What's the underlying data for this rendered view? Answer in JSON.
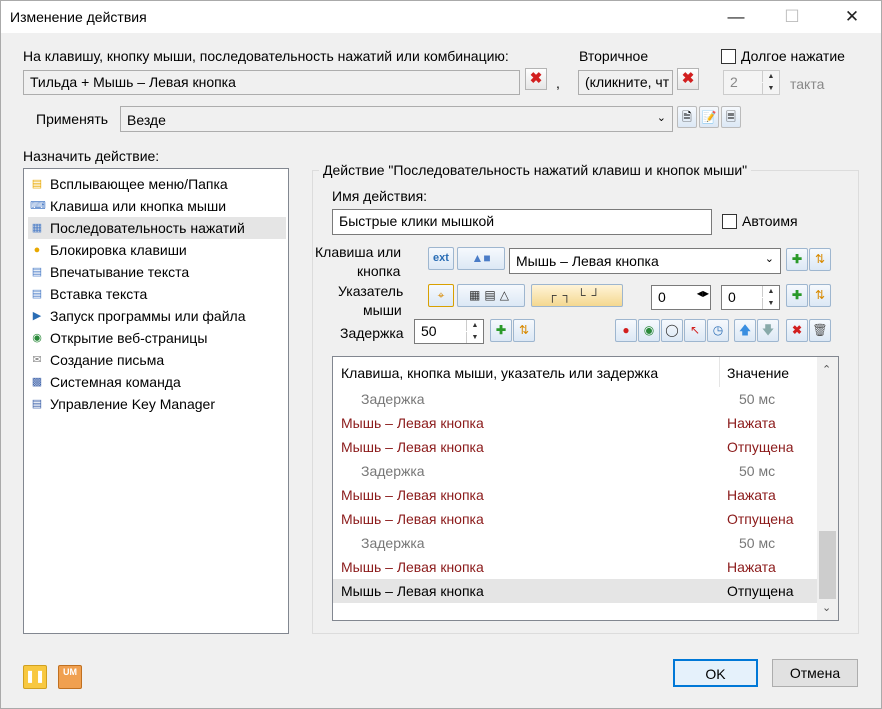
{
  "window": {
    "title": "Изменение действия"
  },
  "trigger": {
    "label": "На клавишу, кнопку мыши, последовательность нажатий или комбинацию:",
    "value": "Тильда + Мышь – Левая кнопка",
    "comma": ",",
    "secondary_label": "Вторичное",
    "secondary_value": "(кликните, чт",
    "long_press_label": "Долгое нажатие",
    "long_press_value": "2",
    "long_press_unit": "такта"
  },
  "apply": {
    "label": "Применять",
    "value": "Везде"
  },
  "assign": {
    "label": "Назначить действие:",
    "items": [
      {
        "label": "Всплывающее меню/Папка",
        "icon": "menu-icon"
      },
      {
        "label": "Клавиша или кнопка мыши",
        "icon": "key-icon"
      },
      {
        "label": "Последовательность нажатий",
        "icon": "sequence-icon"
      },
      {
        "label": "Блокировка клавиши",
        "icon": "lock-icon"
      },
      {
        "label": "Впечатывание текста",
        "icon": "text-icon"
      },
      {
        "label": "Вставка текста",
        "icon": "paste-icon"
      },
      {
        "label": "Запуск программы или файла",
        "icon": "run-icon"
      },
      {
        "label": "Открытие веб-страницы",
        "icon": "globe-icon"
      },
      {
        "label": "Создание письма",
        "icon": "mail-icon"
      },
      {
        "label": "Системная команда",
        "icon": "system-icon"
      },
      {
        "label": "Управление Key Manager",
        "icon": "manager-icon"
      }
    ]
  },
  "action": {
    "group_title": "Действие \"Последовательность нажатий клавиш и кнопок мыши\"",
    "name_label": "Имя действия:",
    "name_value": "Быстрые клики мышкой",
    "autoname_label": "Автоимя",
    "key_label_1": "Клавиша или",
    "key_label_2": "кнопка",
    "ext_label": "ext",
    "key_value": "Мышь – Левая кнопка",
    "pointer_label_1": "Указатель",
    "pointer_label_2": "мыши",
    "pointer_x": "0",
    "pointer_y": "0",
    "delay_label": "Задержка",
    "delay_value": "50"
  },
  "sequence": {
    "columns": [
      "Клавиша, кнопка мыши, указатель или задержка",
      "Значение"
    ],
    "rows": [
      {
        "item": "Задержка",
        "value": "50 мс",
        "kind": "delay"
      },
      {
        "item": "Мышь – Левая кнопка",
        "value": "Нажата",
        "kind": "mouse"
      },
      {
        "item": "Мышь – Левая кнопка",
        "value": "Отпущена",
        "kind": "mouse"
      },
      {
        "item": "Задержка",
        "value": "50 мс",
        "kind": "delay"
      },
      {
        "item": "Мышь – Левая кнопка",
        "value": "Нажата",
        "kind": "mouse"
      },
      {
        "item": "Мышь – Левая кнопка",
        "value": "Отпущена",
        "kind": "mouse"
      },
      {
        "item": "Задержка",
        "value": "50 мс",
        "kind": "delay"
      },
      {
        "item": "Мышь – Левая кнопка",
        "value": "Нажата",
        "kind": "mouse"
      },
      {
        "item": "Мышь – Левая кнопка",
        "value": "Отпущена",
        "kind": "selected"
      }
    ]
  },
  "footer": {
    "ok": "OK",
    "cancel": "Отмена",
    "um_label": "UM"
  },
  "colors": {
    "mouse_row": "#8b1a1a",
    "delay_row": "#777777",
    "selected_row": "#e5e5e5",
    "accent": "#0078d7"
  }
}
